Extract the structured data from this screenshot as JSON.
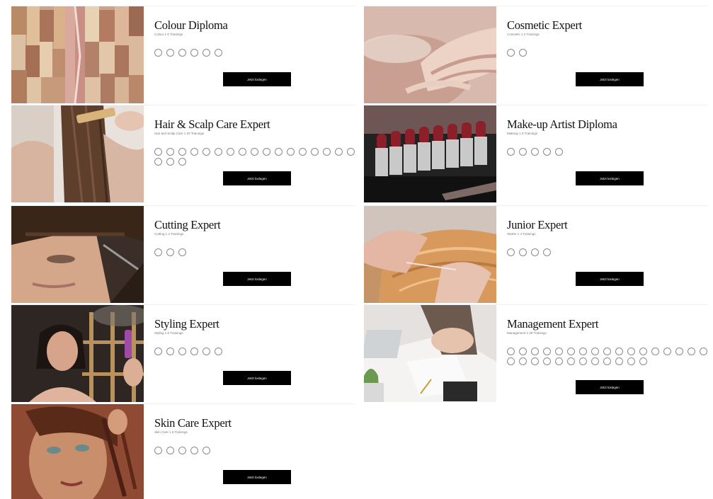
{
  "cards": [
    {
      "title": "Colour Diploma",
      "subtitle": "Colour 1 6 Trainings",
      "progress_total": 6,
      "button_label": "Jetzt loslegen"
    },
    {
      "title": "Cosmetic Expert",
      "subtitle": "Cosmetic 1 2 Trainings",
      "progress_total": 2,
      "button_label": "Jetzt loslegen"
    },
    {
      "title": "Hair & Scalp Care Expert",
      "subtitle": "Hair and Scalp Care 1 20 Trainings",
      "progress_total": 20,
      "button_label": "Jetzt loslegen"
    },
    {
      "title": "Make-up Artist Diploma",
      "subtitle": "Makeup 1 5 Trainings",
      "progress_total": 5,
      "button_label": "Jetzt loslegen"
    },
    {
      "title": "Cutting Expert",
      "subtitle": "Cutting 1 3 Trainings",
      "progress_total": 3,
      "button_label": "Jetzt loslegen"
    },
    {
      "title": "Junior Expert",
      "subtitle": "Starter 1 4 Trainings",
      "progress_total": 4,
      "button_label": "Jetzt loslegen"
    },
    {
      "title": "Styling Expert",
      "subtitle": "Styling 1 6 Trainings",
      "progress_total": 6,
      "button_label": "Jetzt loslegen"
    },
    {
      "title": "Management Expert",
      "subtitle": "Management 1 29 Trainings",
      "progress_total": 29,
      "button_label": "Jetzt loslegen"
    },
    {
      "title": "Skin Care Expert",
      "subtitle": "Skin Care 1 5 Trainings",
      "progress_total": 5,
      "button_label": "Jetzt loslegen"
    }
  ]
}
